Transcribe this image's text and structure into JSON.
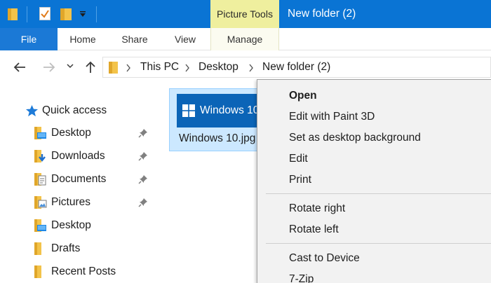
{
  "titlebar": {
    "contextual_tab": "Picture Tools",
    "window_title": "New folder (2)"
  },
  "ribbon": {
    "tabs": [
      "File",
      "Home",
      "Share",
      "View",
      "Manage"
    ]
  },
  "address": {
    "crumbs": [
      "This PC",
      "Desktop",
      "New folder (2)"
    ]
  },
  "navpane": {
    "quick_access": "Quick access",
    "items": [
      {
        "label": "Desktop",
        "pinned": true,
        "icon": "desktop-folder-icon"
      },
      {
        "label": "Downloads",
        "pinned": true,
        "icon": "downloads-folder-icon"
      },
      {
        "label": "Documents",
        "pinned": true,
        "icon": "documents-folder-icon"
      },
      {
        "label": "Pictures",
        "pinned": true,
        "icon": "pictures-folder-icon"
      },
      {
        "label": "Desktop",
        "pinned": false,
        "icon": "desktop-folder-icon"
      },
      {
        "label": "Drafts",
        "pinned": false,
        "icon": "folder-icon"
      },
      {
        "label": "Recent Posts",
        "pinned": false,
        "icon": "folder-icon"
      }
    ]
  },
  "file": {
    "thumbnail_text": "Windows 10",
    "name": "Windows 10.jpg"
  },
  "context_menu": {
    "items": [
      "Open",
      "Edit with Paint 3D",
      "Set as desktop background",
      "Edit",
      "Print",
      "Rotate right",
      "Rotate left",
      "Cast to Device",
      "7-Zip"
    ]
  },
  "colors": {
    "titlebar": "#0a74d4",
    "file_tab": "#1b79d6",
    "picture_tools": "#efef9e",
    "selection": "#cce8ff",
    "menu_bg": "#f2f2f2"
  }
}
